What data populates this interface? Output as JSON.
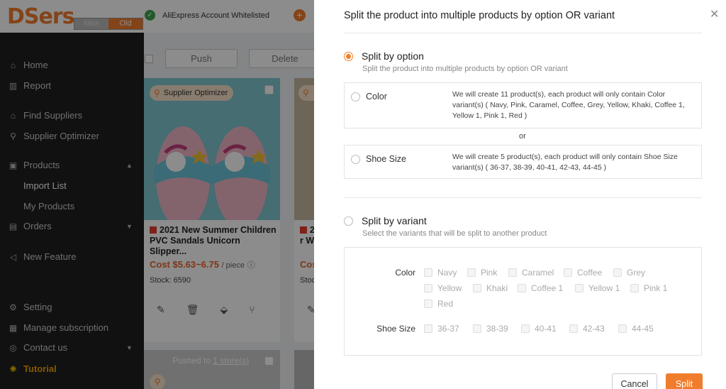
{
  "app": {
    "logo": "DSers",
    "version_new": "New",
    "version_old": "Old",
    "whitelist_text": "AliExpress Account Whitelisted"
  },
  "sidebar": {
    "items": [
      {
        "label": "Home",
        "icon": "home-icon"
      },
      {
        "label": "Report",
        "icon": "report-icon"
      },
      {
        "label": "Find Suppliers",
        "icon": "find-suppliers-icon"
      },
      {
        "label": "Supplier Optimizer",
        "icon": "search-icon"
      },
      {
        "label": "Products",
        "icon": "products-icon"
      },
      {
        "label": "Import List"
      },
      {
        "label": "My Products"
      },
      {
        "label": "Orders",
        "icon": "orders-icon"
      },
      {
        "label": "New Feature",
        "icon": "megaphone-icon"
      },
      {
        "label": "Setting",
        "icon": "gear-icon"
      },
      {
        "label": "Manage subscription",
        "icon": "subscription-icon"
      },
      {
        "label": "Contact us",
        "icon": "contact-icon"
      },
      {
        "label": "Tutorial",
        "icon": "bulb-icon"
      }
    ]
  },
  "toolbar": {
    "push_label": "Push",
    "delete_label": "Delete"
  },
  "cards": [
    {
      "supplier_optimizer": "Supplier Optimizer",
      "title": "2021 New Summer Children PVC Sandals Unicorn Slipper...",
      "cost": "Cost $5.63~6.75",
      "per": "/ piece",
      "stock": "Stock: 6590"
    },
    {
      "title_fragment_1": "2",
      "title_fragment_2": "r W",
      "cost": "Cos",
      "stock": "Stoc"
    }
  ],
  "pushed_banner": {
    "prefix": "Pushed to",
    "link": "1 store(s)"
  },
  "drawer": {
    "title": "Split the product into multiple products by option OR variant",
    "split_by_option": {
      "label": "Split by option",
      "description": "Split the product into multiple products by option OR variant",
      "selected": true,
      "options": [
        {
          "name": "Color",
          "text": "We will create 11 product(s), each product will only contain Color variant(s) ( Navy, Pink, Caramel, Coffee, Grey, Yellow, Khaki, Coffee 1, Yellow 1, Pink 1, Red )"
        },
        {
          "name": "Shoe Size",
          "text": "We will create 5 product(s), each product will only contain Shoe Size variant(s) ( 36-37, 38-39, 40-41, 42-43, 44-45 )"
        }
      ],
      "or": "or"
    },
    "split_by_variant": {
      "label": "Split by variant",
      "description": "Select the variants that will be split to another product",
      "selected": false,
      "color_label": "Color",
      "colors": [
        "Navy",
        "Pink",
        "Caramel",
        "Coffee",
        "Grey",
        "Yellow",
        "Khaki",
        "Coffee 1",
        "Yellow 1",
        "Pink 1",
        "Red"
      ],
      "size_label": "Shoe Size",
      "sizes": [
        "36-37",
        "38-39",
        "40-41",
        "42-43",
        "44-45"
      ]
    },
    "cancel_label": "Cancel",
    "split_label": "Split"
  },
  "colors": {
    "accent": "#f07d2c",
    "sidebar_bg": "#1f1f1f",
    "price": "#e8632b"
  }
}
